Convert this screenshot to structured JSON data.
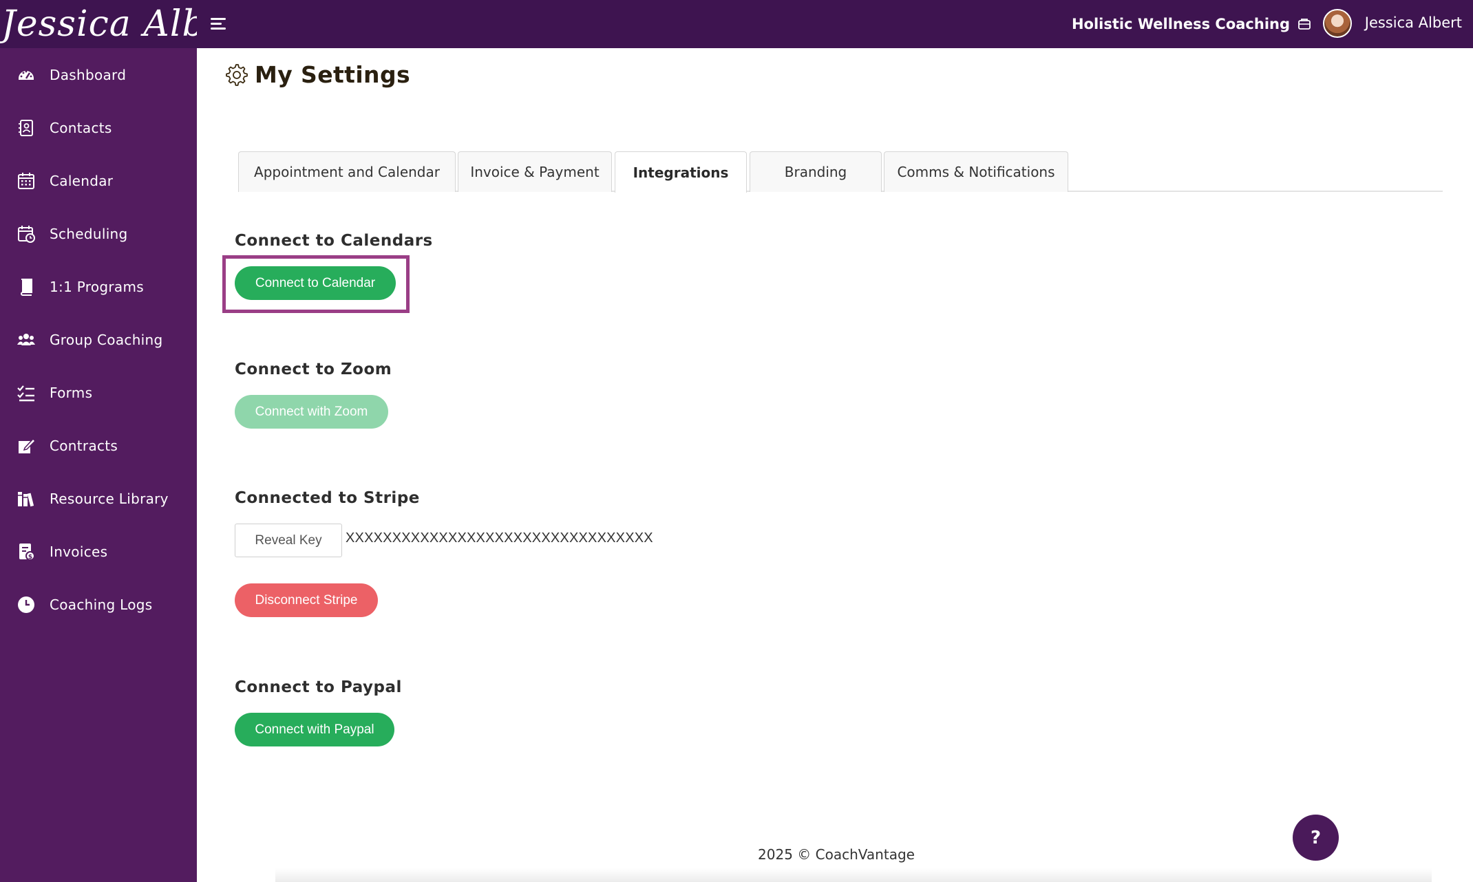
{
  "header": {
    "logo_text": "Jessica Albert",
    "business_name": "Holistic Wellness Coaching",
    "user_name": "Jessica Albert"
  },
  "sidebar": {
    "items": [
      {
        "label": "Dashboard",
        "icon": "dashboard-icon"
      },
      {
        "label": "Contacts",
        "icon": "contacts-icon"
      },
      {
        "label": "Calendar",
        "icon": "calendar-icon"
      },
      {
        "label": "Scheduling",
        "icon": "scheduling-icon"
      },
      {
        "label": "1:1 Programs",
        "icon": "book-icon"
      },
      {
        "label": "Group Coaching",
        "icon": "users-icon"
      },
      {
        "label": "Forms",
        "icon": "checklist-icon"
      },
      {
        "label": "Contracts",
        "icon": "contract-sign-icon"
      },
      {
        "label": "Resource Library",
        "icon": "library-icon"
      },
      {
        "label": "Invoices",
        "icon": "invoice-icon"
      },
      {
        "label": "Coaching Logs",
        "icon": "clock-icon"
      }
    ]
  },
  "page": {
    "title": "My Settings"
  },
  "tabs": [
    {
      "label": "Appointment and Calendar",
      "active": false
    },
    {
      "label": "Invoice & Payment",
      "active": false
    },
    {
      "label": "Integrations",
      "active": true
    },
    {
      "label": "Branding",
      "active": false
    },
    {
      "label": "Comms & Notifications",
      "active": false
    }
  ],
  "integrations": {
    "calendars": {
      "title": "Connect to Calendars",
      "button": "Connect to Calendar"
    },
    "zoom": {
      "title": "Connect to Zoom",
      "button": "Connect with Zoom"
    },
    "stripe": {
      "title": "Connected to Stripe",
      "reveal_button": "Reveal Key",
      "masked_key": "XXXXXXXXXXXXXXXXXXXXXXXXXXXXXXXXX",
      "disconnect_button": "Disconnect Stripe"
    },
    "paypal": {
      "title": "Connect to Paypal",
      "button": "Connect with Paypal"
    }
  },
  "footer": {
    "text": "2025 © CoachVantage"
  },
  "help": {
    "label": "?"
  },
  "colors": {
    "topbar": "#3e1450",
    "sidebar": "#531c5f",
    "primary_green": "#27ad5b",
    "disabled_green": "#8fd6ab",
    "danger_red": "#ec6166",
    "highlight_border": "#9a3e86"
  }
}
